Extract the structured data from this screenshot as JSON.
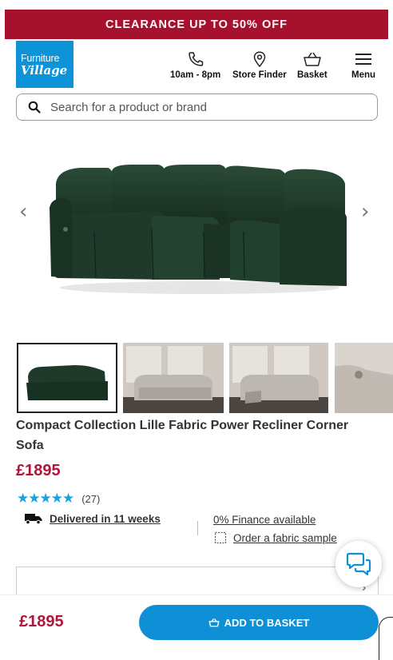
{
  "promo": {
    "text": "CLEARANCE UP TO 50% OFF"
  },
  "logo": {
    "line1": "Furniture",
    "line2": "Village"
  },
  "header": {
    "hours": "10am - 8pm",
    "store_finder": "Store Finder",
    "basket": "Basket",
    "menu": "Menu"
  },
  "search": {
    "placeholder": "Search for a product or brand"
  },
  "product": {
    "title": "Compact Collection Lille Fabric Power Recliner Corner Sofa",
    "price": "£1895",
    "rating_stars": 5,
    "review_count": "(27)",
    "delivery": "Delivered in 11 weeks",
    "finance": "0% Finance available",
    "fabric_sample": "Order a fabric sample"
  },
  "sticky": {
    "price": "£1895",
    "add_to_basket": "ADD TO BASKET"
  },
  "colors": {
    "promo_bg": "#a6122e",
    "brand_blue": "#0e93d9",
    "price_red": "#b0153a",
    "star_blue": "#16a4e0",
    "sofa_green": "#1f3a2a"
  }
}
